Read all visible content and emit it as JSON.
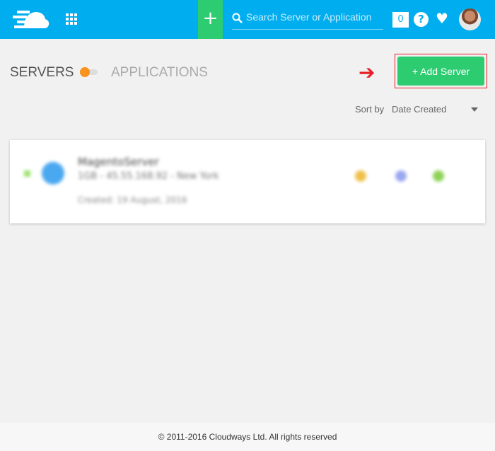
{
  "header": {
    "search_placeholder": "Search Server or Application",
    "notifications_count": "0",
    "help_label": "?",
    "add_symbol": "+"
  },
  "tabs": {
    "servers": "SERVERS",
    "applications": "APPLICATIONS"
  },
  "actions": {
    "add_server": "+ Add Server"
  },
  "sort": {
    "label": "Sort by",
    "value": "Date Created"
  },
  "servers": [
    {
      "name": "MagentoServer",
      "info": "1GB - 45.55.168.92 - New York",
      "created": "Created: 19 August, 2016"
    }
  ],
  "footer": {
    "copyright": "© 2011-2016 Cloudways Ltd. All rights reserved"
  },
  "colors": {
    "header": "#00aeef",
    "accent": "#2ecc71",
    "toggle": "#f7931e",
    "highlight": "#e8202a"
  }
}
